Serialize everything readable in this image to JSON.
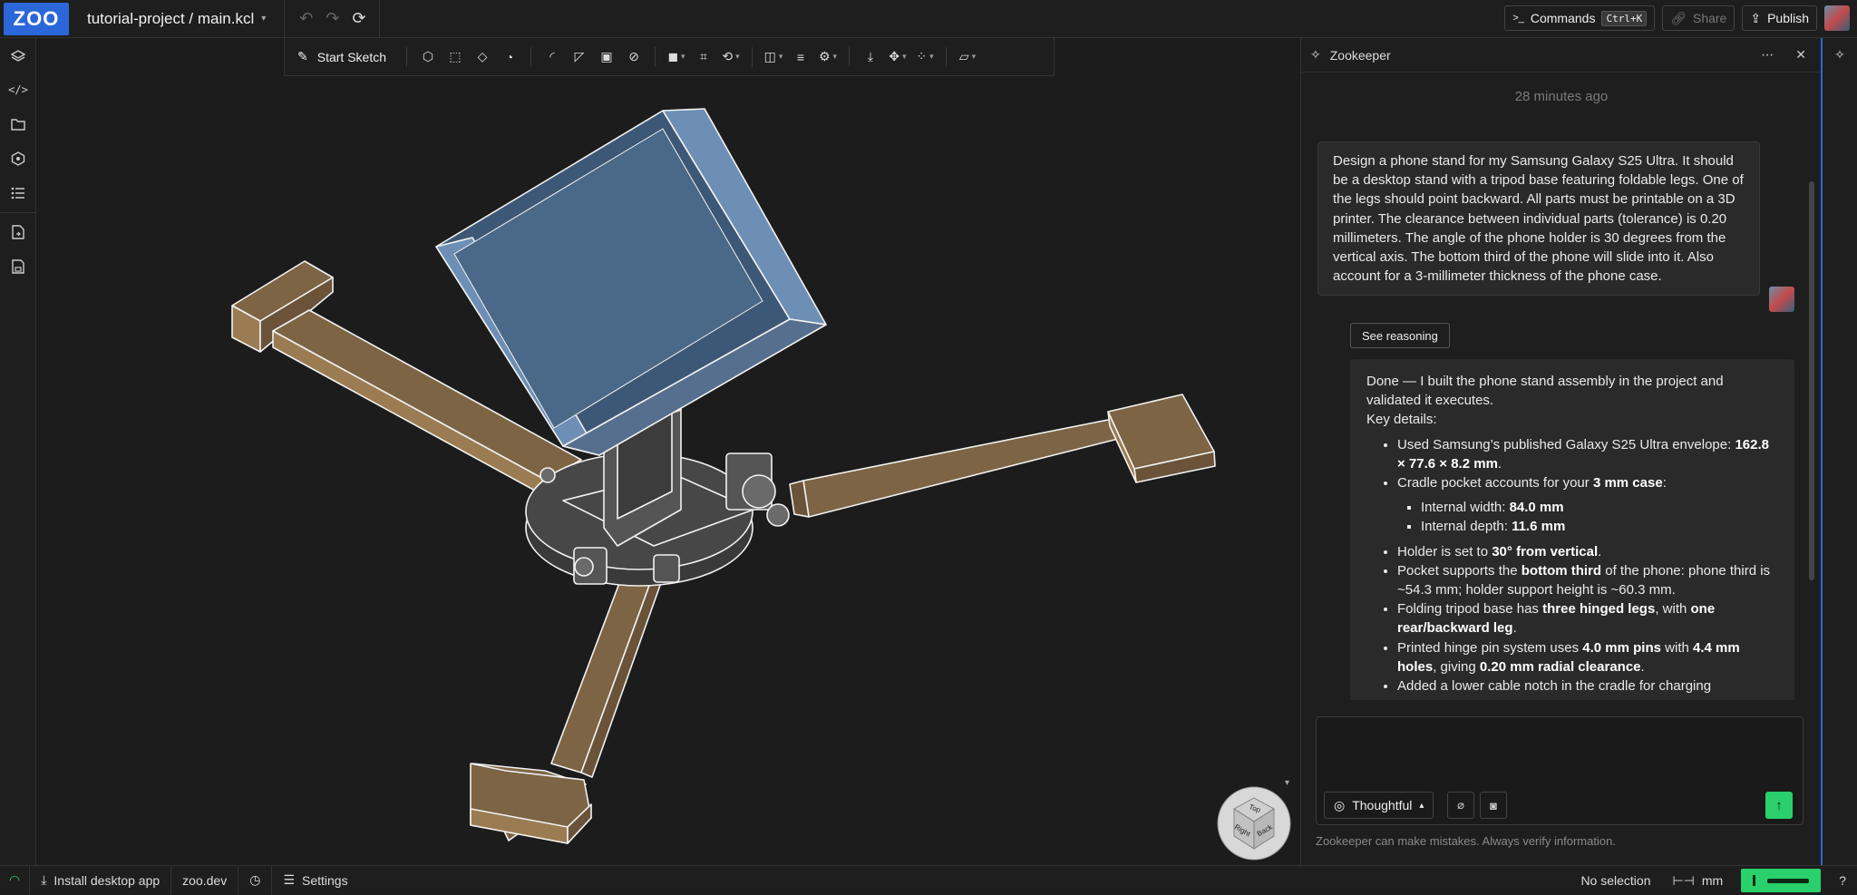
{
  "topbar": {
    "logo": "ZOO",
    "project": "tutorial-project / main.kcl",
    "commands_label": "Commands",
    "commands_shortcut": "Ctrl+K",
    "share_label": "Share",
    "publish_label": "Publish"
  },
  "toolbar": {
    "start_sketch": "Start Sketch"
  },
  "panel": {
    "title": "Zookeeper",
    "time": "28 minutes ago",
    "user_message": "Design a phone stand for my Samsung Galaxy S25 Ultra. It should be a desktop stand with a tripod base featuring foldable legs. One of the legs should point backward. All parts must be printable on a 3D printer. The clearance between individual parts (tolerance) is 0.20 millimeters. The angle of the phone holder is 30 degrees from the vertical axis. The bottom third of the phone will slide into it. Also account for a 3-millimeter thickness of the phone case.",
    "see_reasoning": "See reasoning",
    "bot": {
      "intro": "Done — I built the phone stand assembly in the project and validated it executes.",
      "key_details": "Key details:",
      "b1_pre": "Used Samsung’s published Galaxy S25 Ultra envelope:",
      "b1_bold": "162.8 × 77.6 × 8.2 mm",
      "b1_post": ".",
      "b2_pre": "Cradle pocket accounts for your",
      "b2_bold": "3 mm case",
      "b2_post": ":",
      "sub1_pre": "Internal width:",
      "sub1_bold": "84.0 mm",
      "sub2_pre": "Internal depth:",
      "sub2_bold": "11.6 mm",
      "b3_pre": "Holder is set to",
      "b3_bold": "30° from vertical",
      "b3_post": ".",
      "b4_pre": "Pocket supports the",
      "b4_bold": "bottom third",
      "b4_post": "of the phone: phone third is ~54.3 mm; holder support height is ~60.3 mm.",
      "b5_pre": "Folding tripod base has",
      "b5_bold1": "three hinged legs",
      "b5_mid": ", with",
      "b5_bold2": "one rear/backward leg",
      "b5_post": ".",
      "b6_pre": "Printed hinge pin system uses",
      "b6_bold1": "4.0 mm pins",
      "b6_mid": "with",
      "b6_bold2": "4.4 mm holes",
      "b6_mid2": ", giving",
      "b6_bold3": "0.20 mm radial clearance",
      "b6_post": ".",
      "b7": "Added a lower cable notch in the cradle for charging"
    },
    "mode": "Thoughtful",
    "disclaimer": "Zookeeper can make mistakes. Always verify information."
  },
  "navcube": {
    "top": "Top",
    "right": "Right",
    "back": "Back"
  },
  "statusbar": {
    "install": "Install desktop app",
    "site": "zoo.dev",
    "settings": "Settings",
    "selection": "No selection",
    "units": "mm",
    "help": "?"
  },
  "colors": {
    "accent": "#2b67d9",
    "leg": "#7a6040",
    "holder": "#3d5876",
    "success": "#29d06b"
  }
}
